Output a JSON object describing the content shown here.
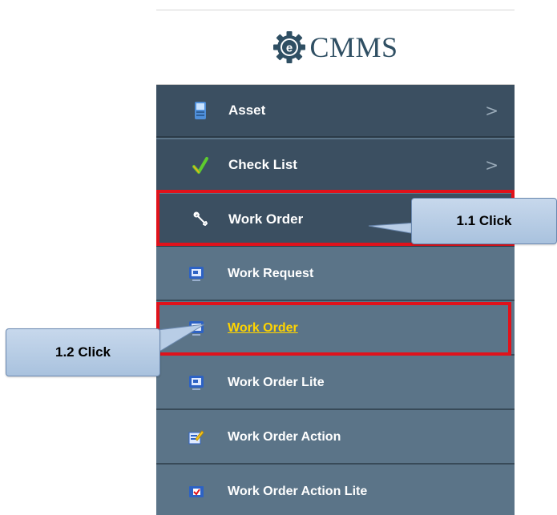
{
  "logo": {
    "text": "CMMS",
    "icon": "gear-e-icon"
  },
  "menu": {
    "main_items": [
      {
        "label": "Asset",
        "icon": "asset-icon",
        "arrow": ">"
      },
      {
        "label": "Check List",
        "icon": "checkmark-icon",
        "arrow": ">"
      },
      {
        "label": "Work Order",
        "icon": "wrench-icon"
      }
    ],
    "sub_items": [
      {
        "label": "Work Request",
        "icon": "monitor-icon"
      },
      {
        "label": "Work Order",
        "icon": "monitor-icon",
        "active": true
      },
      {
        "label": "Work Order Lite",
        "icon": "monitor-icon"
      },
      {
        "label": "Work Order Action",
        "icon": "edit-icon"
      },
      {
        "label": "Work Order Action Lite",
        "icon": "checkbox-icon"
      }
    ]
  },
  "callouts": {
    "step1": "1.1 Click",
    "step2": "1.2 Click"
  },
  "colors": {
    "main_bg": "#3b4f61",
    "sub_bg": "#5b7488",
    "highlight": "#e0121b",
    "active_link": "#ffd400",
    "callout_fill": "#b8cde6"
  }
}
